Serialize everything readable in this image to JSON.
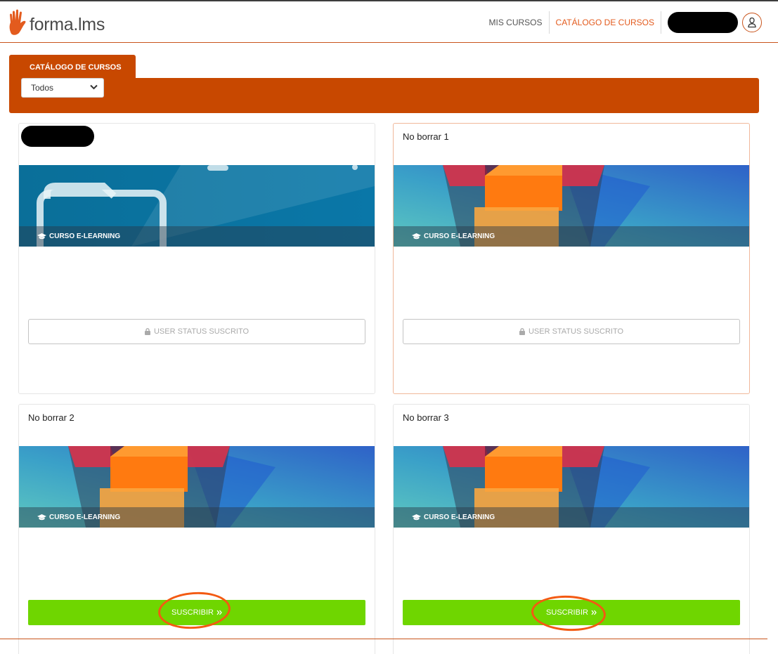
{
  "header": {
    "logo_text": "forma.lms",
    "nav": [
      {
        "label": "MIS CURSOS",
        "active": false
      },
      {
        "label": "CATÁLOGO DE CURSOS",
        "active": true
      }
    ],
    "user_icon": "user-outline-icon"
  },
  "catalog": {
    "tab_label": "CATÁLOGO DE CURSOS",
    "filter_selected": "Todos"
  },
  "cards": [
    {
      "title": "",
      "title_redacted": true,
      "type_label": "CURSO E-LEARNING",
      "image": "folder-image",
      "action": "USER STATUS SUSCRITO",
      "action_type": "status"
    },
    {
      "title": "No borrar 1",
      "type_label": "CURSO E-LEARNING",
      "image": "cube-image",
      "action": "USER STATUS SUSCRITO",
      "action_type": "status"
    },
    {
      "title": "No borrar 2",
      "type_label": "CURSO E-LEARNING",
      "image": "cube-image",
      "action": "SUSCRIBIR",
      "action_type": "subscribe"
    },
    {
      "title": "No borrar 3",
      "type_label": "CURSO E-LEARNING",
      "image": "cube-image",
      "action": "SUSCRIBIR",
      "action_type": "subscribe"
    }
  ],
  "colors": {
    "brand": "#c84800",
    "accent": "#e35b1e",
    "subscribe": "#6fd600",
    "annotation": "#f35a12"
  }
}
